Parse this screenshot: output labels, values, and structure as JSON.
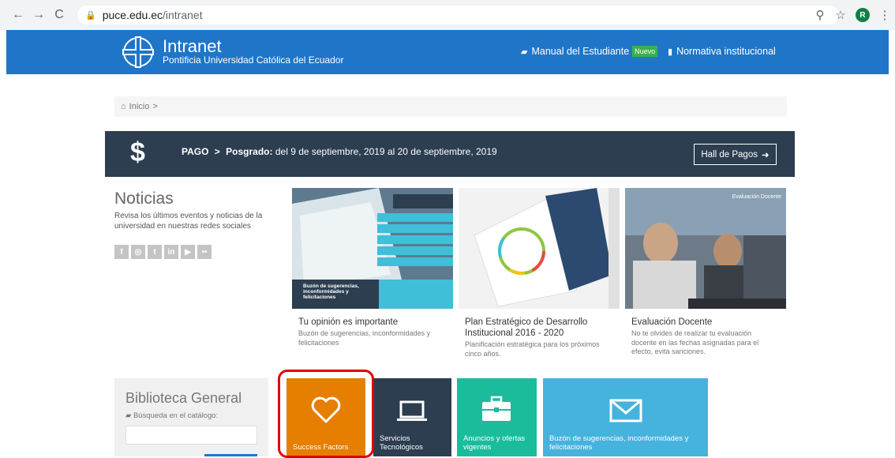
{
  "browser": {
    "back": "←",
    "forward": "→",
    "reload": "C",
    "url_host": "puce.edu.ec",
    "url_path": "/intranet",
    "avatar_letter": "R"
  },
  "header": {
    "title": "Intranet",
    "subtitle": "Pontificia Universidad Católica del Ecuador",
    "link_manual": "Manual del Estudiante",
    "badge_new": "Nuevo",
    "link_normativa": "Normativa institucional",
    "color": "#1f76c8"
  },
  "breadcrumb": {
    "home": "Inicio",
    "sep": ">"
  },
  "payment": {
    "symbol": "$",
    "label": "PAGO",
    "arrow": ">",
    "type": "Posgrado:",
    "dates": "del 9 de septiembre, 2019 al 20 de septiembre, 2019",
    "button": "Hall de Pagos"
  },
  "news": {
    "title": "Noticias",
    "description": "Revisa los últimos eventos y noticias de la universidad en nuestras redes sociales",
    "social_icons": [
      "f",
      "◎",
      "t",
      "in",
      "▶",
      "••"
    ],
    "cards": [
      {
        "title": "Tu opinión es importante",
        "description": "Buzón de sugerencias, inconformidades y felicitaciones",
        "img_caption": "Buzón de sugerencias, inconformidades y felicitaciones"
      },
      {
        "title": "Plan Estratégico de Desarrollo Institucional 2016 - 2020",
        "description": "Planificación estratégica para los próximos cinco años."
      },
      {
        "title": "Evaluación Docente",
        "description": "No te olvides de realizar tu evaluación docente en las fechas asignadas para el efecto, evita sanciones.",
        "img_tag": "Evaluación Docente"
      }
    ]
  },
  "library": {
    "title": "Biblioteca General",
    "label": "Búsqueda en el catálogo:"
  },
  "tiles": [
    {
      "label": "Success Factors",
      "color": "#e67e00"
    },
    {
      "label": "Servicios Tecnológicos",
      "color": "#2c3e50"
    },
    {
      "label": "Anuncios y ofertas vigentes",
      "color": "#1abc9c"
    },
    {
      "label": "Buzón de sugerencias, inconformidades y felicitaciones",
      "color": "#45b3de"
    }
  ]
}
